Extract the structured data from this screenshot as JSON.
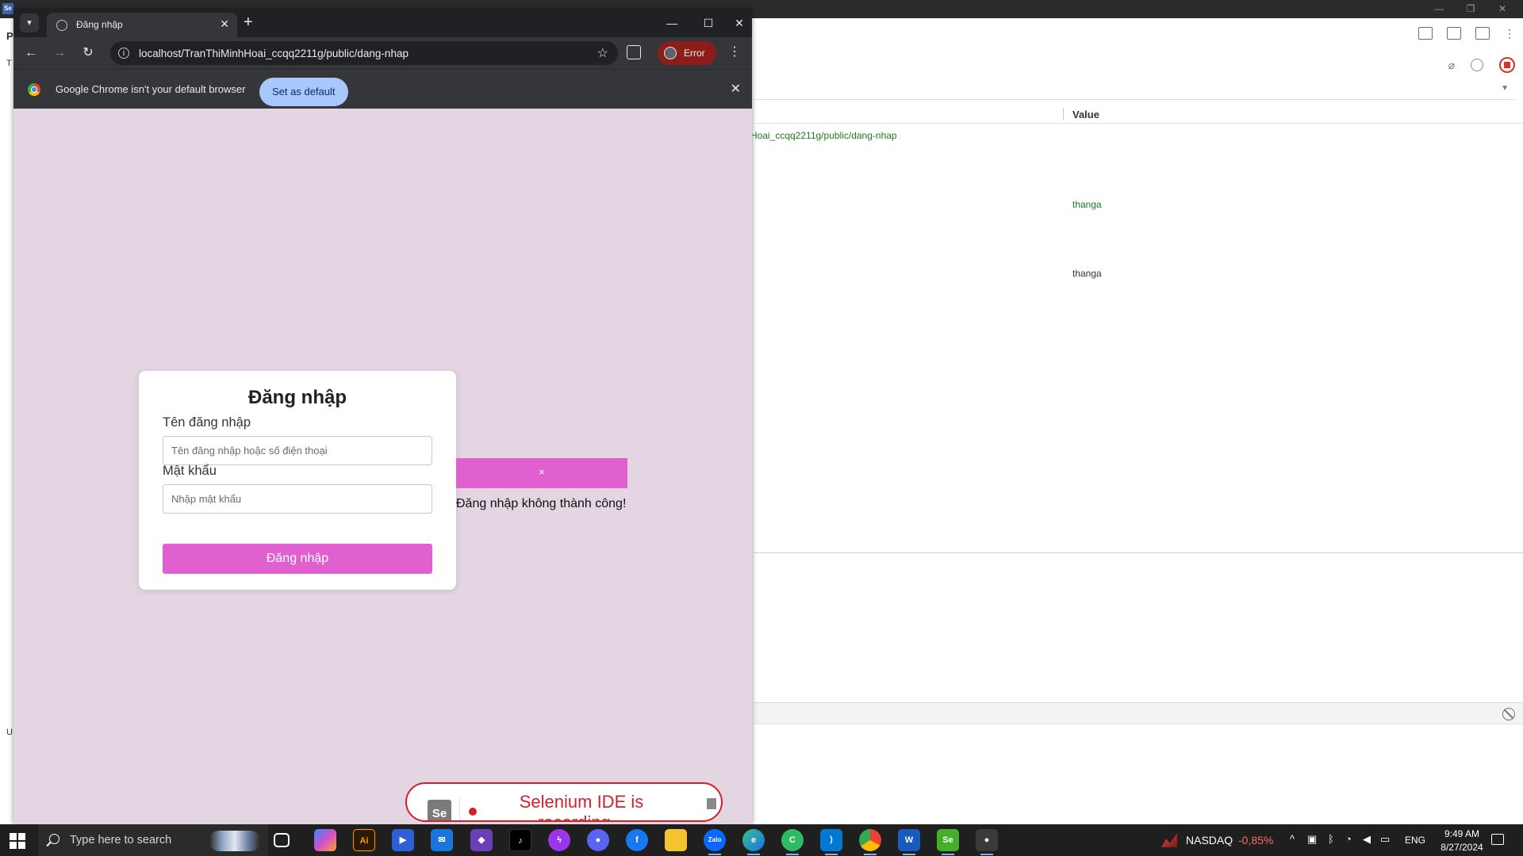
{
  "ide": {
    "value_header": "Value",
    "rows": [
      "Hoai_ccqq2211g/public/dang-nhap",
      "thanga",
      "thanga"
    ]
  },
  "chrome": {
    "tab_title": "Đăng nhập",
    "url": "localhost/TranThiMinhHoai_ccqq2211g/public/dang-nhap",
    "profile_status": "Error",
    "infobar_message": "Google Chrome isn't your default browser",
    "set_default_label": "Set as default"
  },
  "login": {
    "title": "Đăng nhập",
    "username_label": "Tên đăng nhập",
    "username_placeholder": "Tên đăng nhập hoặc số điện thoại",
    "password_label": "Mật khẩu",
    "password_placeholder": "Nhập mật khẩu",
    "submit_label": "Đăng nhập"
  },
  "toast": {
    "close": "×",
    "message": "Đăng nhập không thành công!"
  },
  "selenium_banner": {
    "logo": "Se",
    "text": "Selenium IDE is recording..."
  },
  "taskbar": {
    "search_placeholder": "Type here to search",
    "apps": [
      "task-view",
      "copilot",
      "illustrator",
      "power-automate",
      "mail",
      "visual-studio",
      "tiktok",
      "messenger",
      "discord",
      "facebook",
      "file-explorer",
      "zalo",
      "edge",
      "coccoc",
      "vscode",
      "chrome",
      "word",
      "selenium",
      "chrome-active"
    ],
    "stock_name": "NASDAQ",
    "stock_change": "-0,85%",
    "language": "ENG",
    "time": "9:49 AM",
    "date": "8/27/2024"
  }
}
